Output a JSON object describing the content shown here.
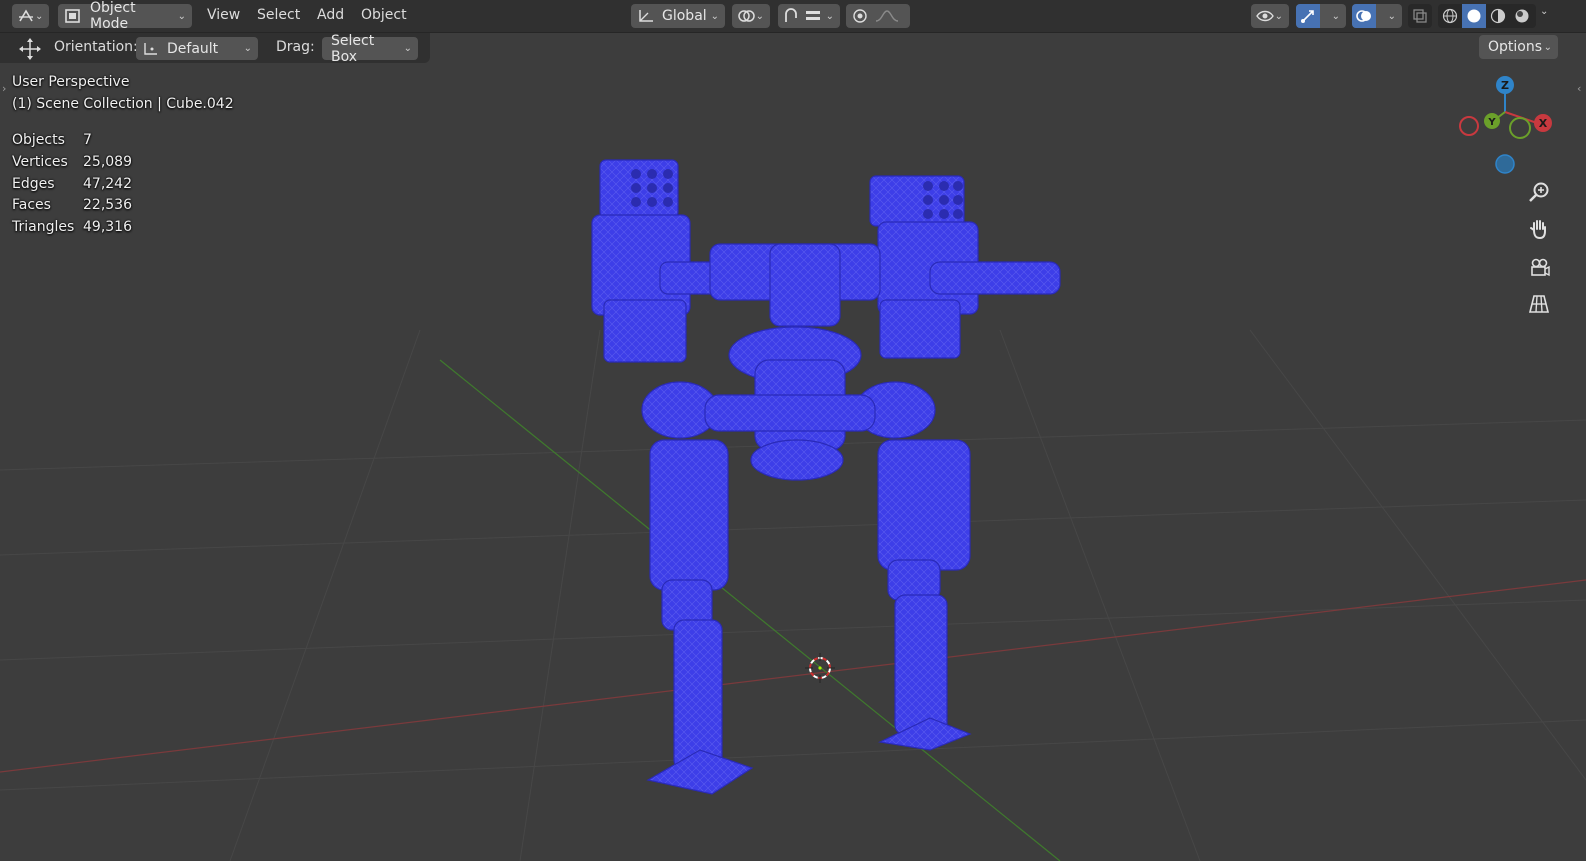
{
  "header": {
    "mode_label": "Object Mode",
    "menus": [
      "View",
      "Select",
      "Add",
      "Object"
    ],
    "transform_orientation": "Global",
    "options_label": "Options"
  },
  "tool_settings": {
    "orientation_label": "Orientation:",
    "orientation_value": "Default",
    "drag_label": "Drag:",
    "drag_value": "Select Box"
  },
  "viewport": {
    "view_name": "User Perspective",
    "collection_line": "(1) Scene Collection | Cube.042",
    "stats": [
      {
        "label": "Objects",
        "value": "7"
      },
      {
        "label": "Vertices",
        "value": "25,089"
      },
      {
        "label": "Edges",
        "value": "47,242"
      },
      {
        "label": "Faces",
        "value": "22,536"
      },
      {
        "label": "Triangles",
        "value": "49,316"
      }
    ],
    "model_color": "#3d3ee8",
    "gizmo": {
      "z_label": "Z",
      "y_label": "Y",
      "x_label": "X"
    }
  },
  "colors": {
    "header_bg": "#303030",
    "viewport_bg": "#3d3d3d",
    "active_accent": "#4772b3",
    "axis_x": "#c8393f",
    "axis_y": "#6ba02a",
    "axis_z": "#2f84c9"
  },
  "icons": [
    "editor-type-icon",
    "object-mode-icon",
    "orientation-icon",
    "pivot-icon",
    "snap-icon",
    "proportional-edit-icon",
    "visibility-icon",
    "gizmo-icon",
    "overlay-icon",
    "xray-icon",
    "wireframe-shading-icon",
    "solid-shading-icon",
    "material-shading-icon",
    "rendered-shading-icon",
    "move-tool-icon",
    "zoom-icon",
    "pan-hand-icon",
    "camera-icon",
    "grid-perspective-icon"
  ]
}
